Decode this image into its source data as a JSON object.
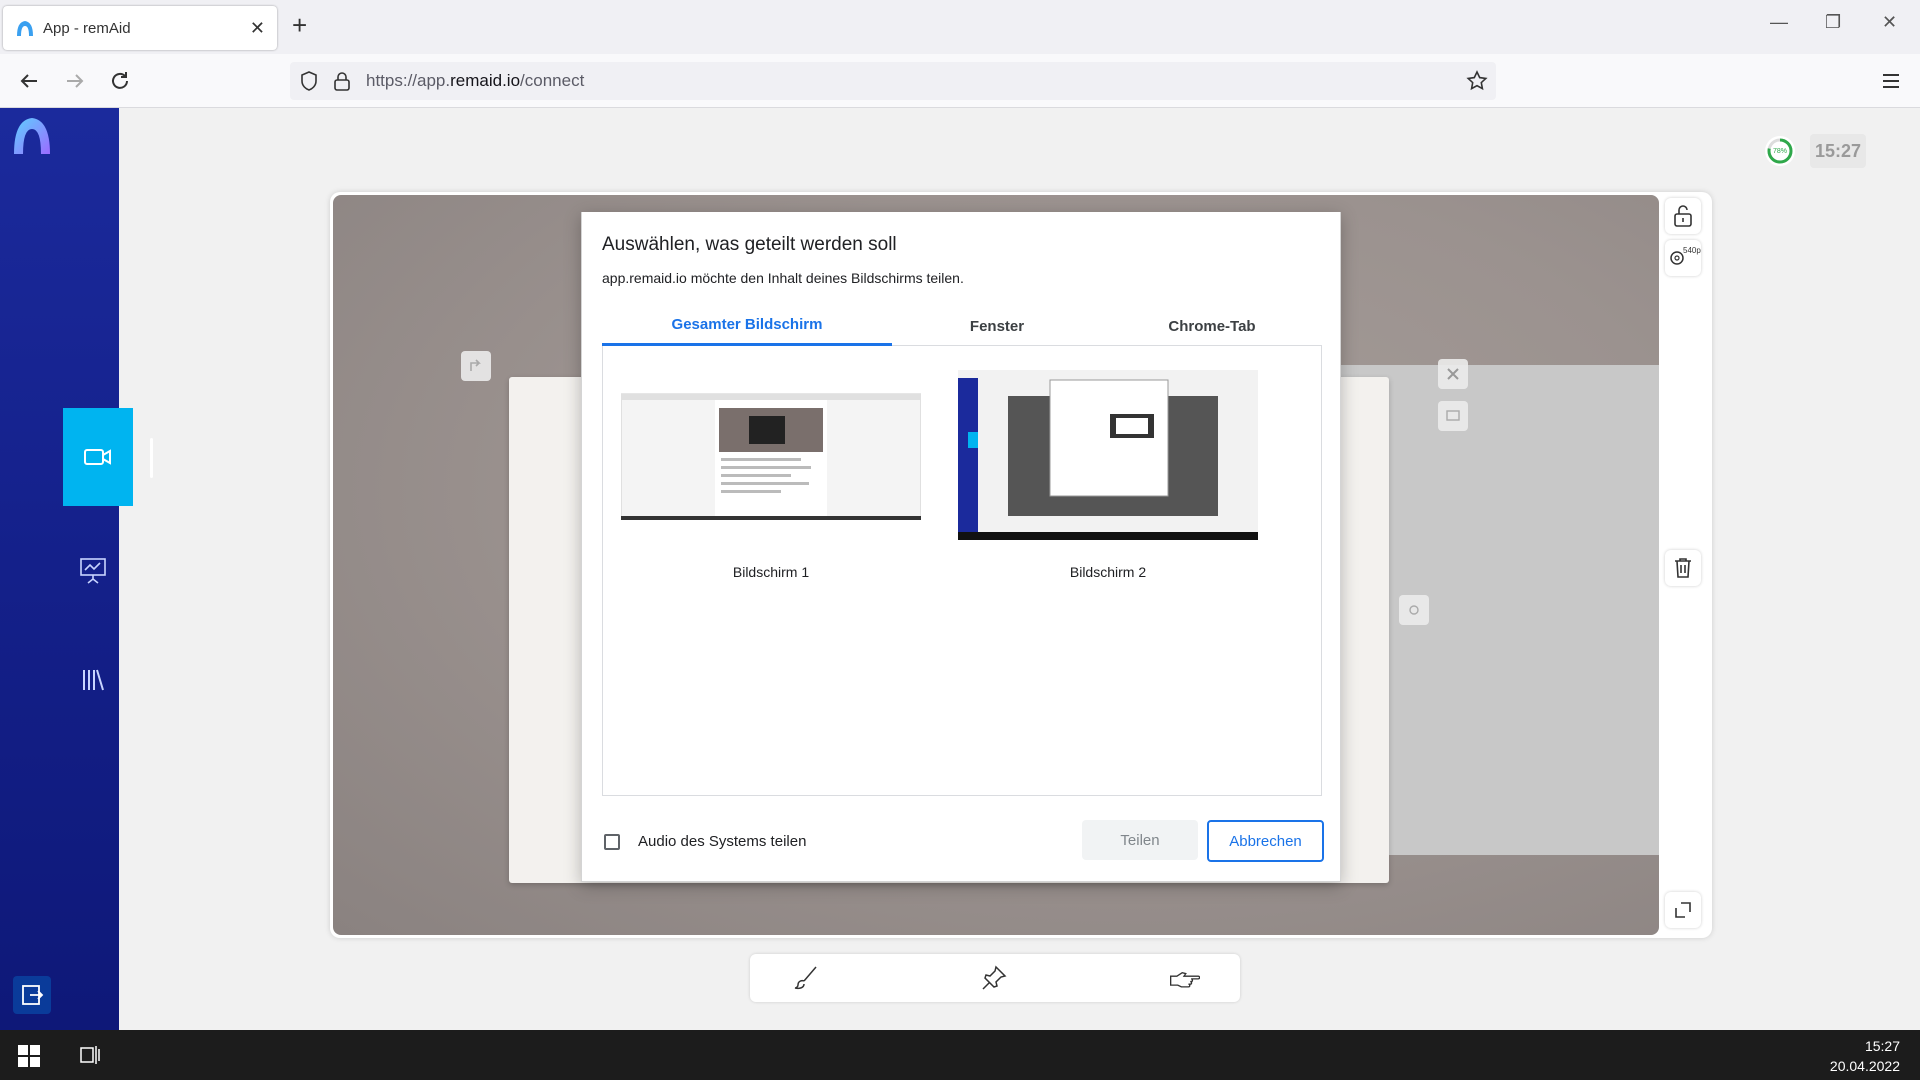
{
  "browser": {
    "tab_title": "App - remAid",
    "tab_close": "✕",
    "new_tab": "+",
    "url_prefix": "https://app.",
    "url_domain": "remaid.io",
    "url_suffix": "/connect",
    "window_controls": [
      "—",
      "❐",
      "✕"
    ]
  },
  "app": {
    "sidebar_items": [
      "video-camera",
      "presentation",
      "library"
    ],
    "status_percent": "78%",
    "clock": "15:27",
    "resolution_badge": "540p"
  },
  "dialog": {
    "title": "Auswählen, was geteilt werden soll",
    "subtitle": "app.remaid.io möchte den Inhalt deines Bildschirms teilen.",
    "tabs": [
      "Gesamter Bildschirm",
      "Fenster",
      "Chrome-Tab"
    ],
    "active_tab": "Gesamter Bildschirm",
    "screens": [
      "Bildschirm 1",
      "Bildschirm 2"
    ],
    "audio_label": "Audio des Systems teilen",
    "audio_checked": false,
    "share_button": "Teilen",
    "cancel_button": "Abbrechen"
  },
  "taskbar": {
    "time": "15:27",
    "date": "20.04.2022"
  },
  "colors": {
    "sidebar": "#1b2a9c",
    "accent": "#00b4f0",
    "dialog_accent": "#1a73e8"
  }
}
